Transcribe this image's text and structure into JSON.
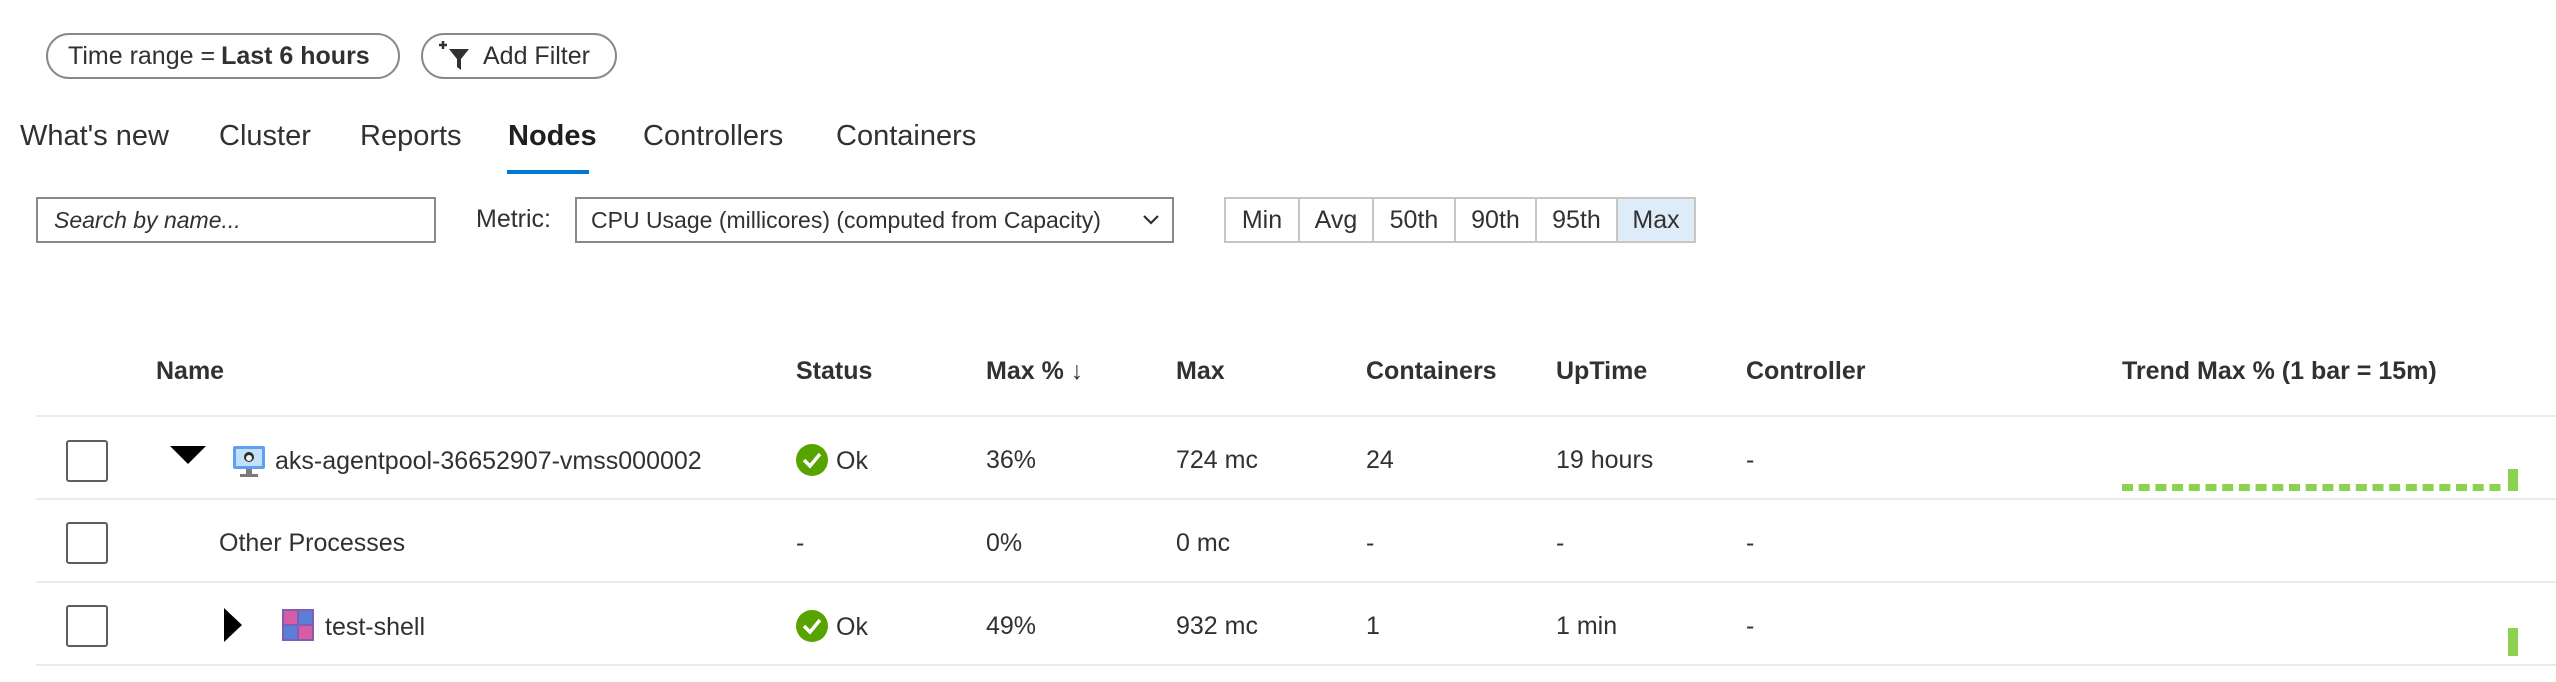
{
  "filters": {
    "time_range_label": "Time range =",
    "time_range_value": "Last 6 hours",
    "add_filter_label": "Add Filter"
  },
  "tabs": [
    {
      "label": "What's new"
    },
    {
      "label": "Cluster"
    },
    {
      "label": "Reports"
    },
    {
      "label": "Nodes",
      "active": true
    },
    {
      "label": "Controllers"
    },
    {
      "label": "Containers"
    }
  ],
  "toolbar": {
    "search_placeholder": "Search by name...",
    "metric_label": "Metric:",
    "metric_value": "CPU Usage (millicores) (computed from Capacity)",
    "aggregations": [
      "Min",
      "Avg",
      "50th",
      "90th",
      "95th",
      "Max"
    ],
    "selected_aggregation": "Max"
  },
  "table": {
    "columns": {
      "name": "Name",
      "status": "Status",
      "max_pct": "Max % ↓",
      "max": "Max",
      "containers": "Containers",
      "uptime": "UpTime",
      "controller": "Controller",
      "trend": "Trend Max % (1 bar = 15m)"
    },
    "rows": [
      {
        "name": "aks-agentpool-36652907-vmss000002",
        "status": "Ok",
        "max_pct": "36%",
        "max": "724 mc",
        "containers": "24",
        "uptime": "19 hours",
        "controller": "-"
      },
      {
        "name": "Other Processes",
        "status": "-",
        "max_pct": "0%",
        "max": "0 mc",
        "containers": "-",
        "uptime": "-",
        "controller": "-"
      },
      {
        "name": "test-shell",
        "status": "Ok",
        "max_pct": "49%",
        "max": "932 mc",
        "containers": "1",
        "uptime": "1 min",
        "controller": "-"
      }
    ]
  },
  "colors": {
    "accent": "#0078d4",
    "ok_green": "#57a300",
    "trend_green": "#8cd150",
    "selected_bg": "#deecf9"
  },
  "icons": {
    "add_filter": "filter-add-icon",
    "dropdown": "chevron-down-icon",
    "node": "node-vm-icon",
    "container": "container-icon",
    "status_ok": "check-circle-icon",
    "expand": "caret-down-icon",
    "collapse": "caret-right-icon"
  }
}
